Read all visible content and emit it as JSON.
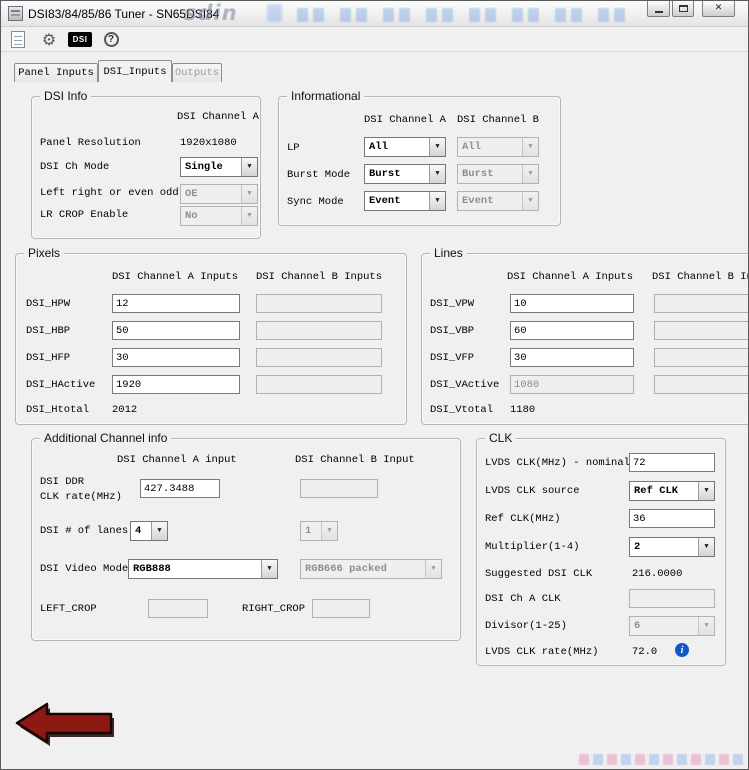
{
  "window": {
    "title": "DSI83/84/85/86 Tuner - SN65DSI84"
  },
  "icons": {
    "gear": "⚙",
    "dsi_badge": "DSI",
    "help": "?",
    "dropdown": "▼",
    "info": "i",
    "close": "✕"
  },
  "watermark": {
    "brand": "sdin"
  },
  "tabs": [
    {
      "label": "Panel Inputs"
    },
    {
      "label": "DSI_Inputs"
    },
    {
      "label": "Outputs"
    }
  ],
  "dsi_info": {
    "title": "DSI Info",
    "col_header": "DSI Channel A",
    "panel_resolution_label": "Panel Resolution",
    "panel_resolution_value": "1920x1080",
    "ch_mode_label": "DSI Ch Mode",
    "ch_mode_value": "Single",
    "lr_label": "Left right or even odd",
    "lr_value": "OE",
    "lr_crop_label": "LR CROP Enable",
    "lr_crop_value": "No"
  },
  "informational": {
    "title": "Informational",
    "col_a": "DSI Channel A",
    "col_b": "DSI Channel B",
    "rows": [
      {
        "label": "LP",
        "a": "All",
        "b": "All"
      },
      {
        "label": "Burst Mode",
        "a": "Burst",
        "b": "Burst"
      },
      {
        "label": "Sync Mode",
        "a": "Event",
        "b": "Event"
      }
    ]
  },
  "pixels": {
    "title": "Pixels",
    "col_a": "DSI Channel A Inputs",
    "col_b": "DSI Channel B Inputs",
    "rows": [
      {
        "label": "DSI_HPW",
        "a": "12"
      },
      {
        "label": "DSI_HBP",
        "a": "50"
      },
      {
        "label": "DSI_HFP",
        "a": "30"
      },
      {
        "label": "DSI_HActive",
        "a": "1920"
      }
    ],
    "total_label": "DSI_Htotal",
    "total_value": "2012"
  },
  "lines": {
    "title": "Lines",
    "col_a": "DSI Channel A Inputs",
    "col_b": "DSI Channel B Inputs",
    "rows": [
      {
        "label": "DSI_VPW",
        "a": "10"
      },
      {
        "label": "DSI_VBP",
        "a": "60"
      },
      {
        "label": "DSI_VFP",
        "a": "30"
      },
      {
        "label": "DSI_VActive",
        "a": "1080"
      }
    ],
    "total_label": "DSI_Vtotal",
    "total_value": "1180"
  },
  "additional": {
    "title": "Additional Channel info",
    "col_a": "DSI Channel A input",
    "col_b": "DSI Channel B Input",
    "ddr_label_1": "DSI DDR",
    "ddr_label_2": "CLK rate(MHz)",
    "ddr_a": "427.3488",
    "lanes_label": "DSI # of lanes",
    "lanes_a": "4",
    "lanes_b": "1",
    "video_label": "DSI Video Mode",
    "video_a": "RGB888",
    "video_b": "RGB666 packed",
    "left_crop_label": "LEFT_CROP",
    "right_crop_label": "RIGHT_CROP"
  },
  "clk": {
    "title": "CLK",
    "nominal_label": "LVDS CLK(MHz) - nominal",
    "nominal_value": "72",
    "source_label": "LVDS CLK source",
    "source_value": "Ref CLK",
    "refclk_label": "Ref CLK(MHz)",
    "refclk_value": "36",
    "mult_label": "Multiplier(1-4)",
    "mult_value": "2",
    "suggested_label": "Suggested DSI CLK",
    "suggested_value": "216.0000",
    "cha_label": "DSI Ch A CLK",
    "divisor_label": "Divisor(1-25)",
    "divisor_value": "6",
    "rate_label": "LVDS CLK rate(MHz)",
    "rate_value": "72.0"
  }
}
